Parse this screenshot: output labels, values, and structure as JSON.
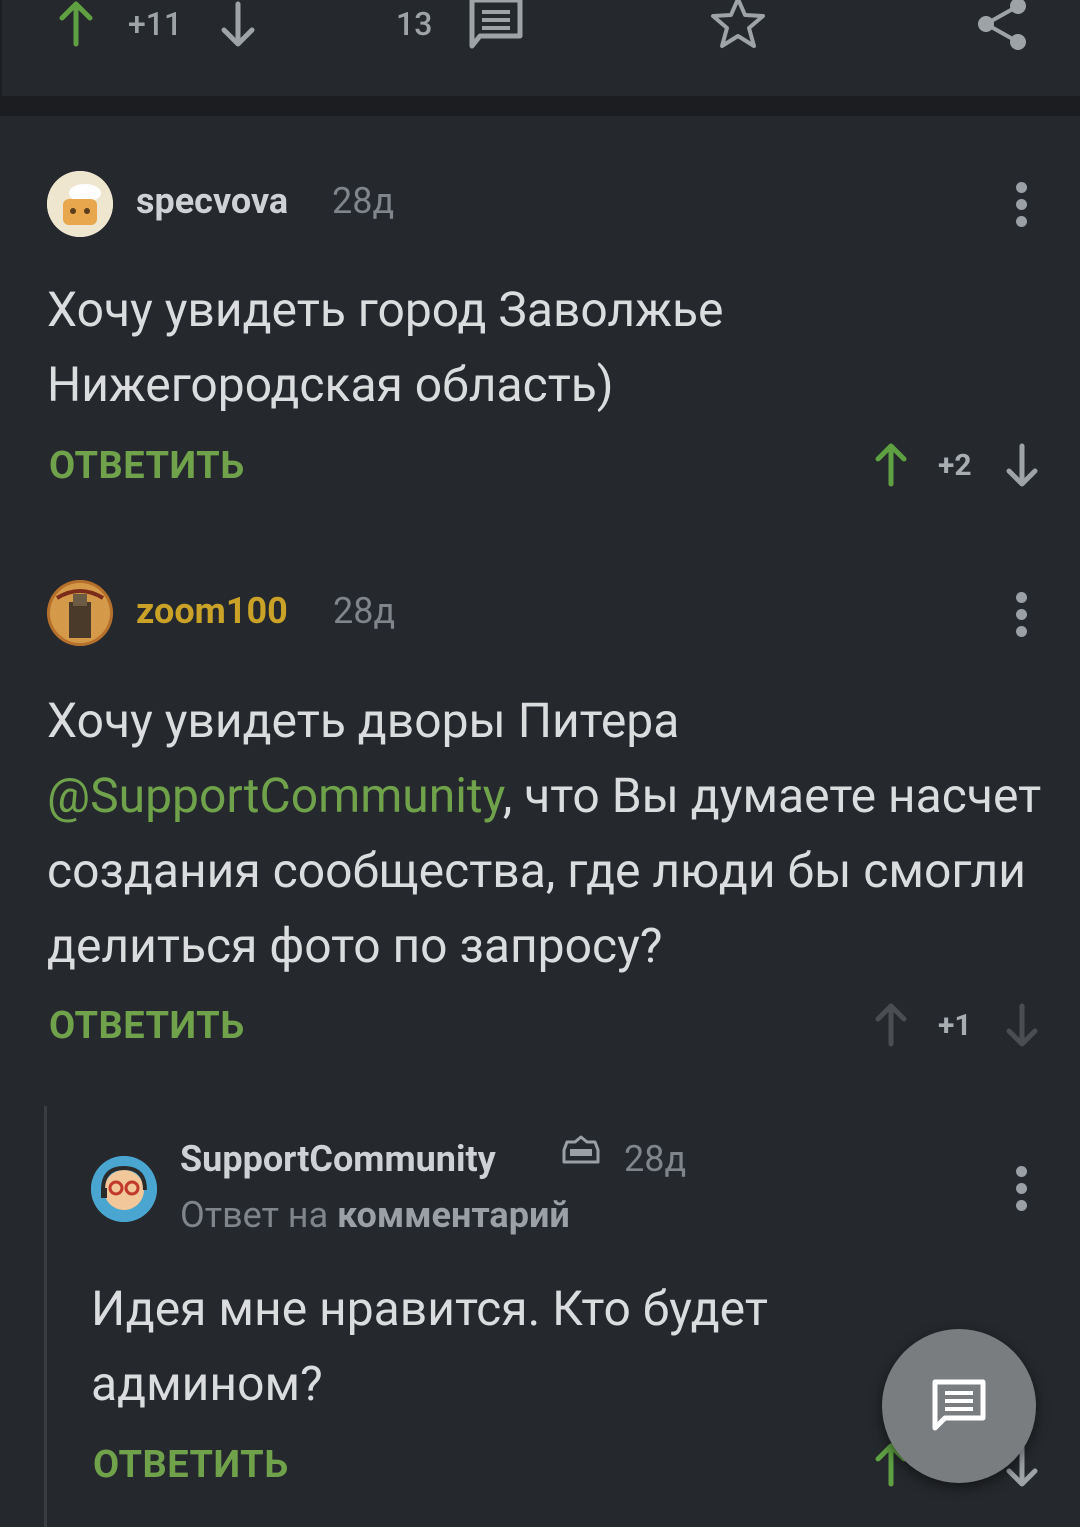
{
  "post_actions": {
    "rating": "+11",
    "comments_count": "13"
  },
  "comments": [
    {
      "author": "specvova",
      "time": "28д",
      "text": "Хочу увидеть город Заволжье Нижегородская область)",
      "reply_label": "ОТВЕТИТЬ",
      "rating": "+2"
    },
    {
      "author": "zoom100",
      "time": "28д",
      "text_mention": "@SupportCommunity",
      "text_before": "Хочу увидеть дворы Питера",
      "text_after": ", что Вы думаете насчет создания сообщества, где люди бы смогли делиться фото по запросу?",
      "reply_label": "ОТВЕТИТЬ",
      "rating": "+1"
    },
    {
      "author": "SupportCommunity",
      "time": "28д",
      "reply_prefix": "Ответ на",
      "reply_target": "комментарий",
      "text": "Идея мне нравится. Кто будет админом?",
      "reply_label": "ОТВЕТИТЬ"
    }
  ],
  "colors": {
    "background": "#25282c",
    "accent_green": "#6fa24a",
    "username_gold": "#c9a227"
  }
}
